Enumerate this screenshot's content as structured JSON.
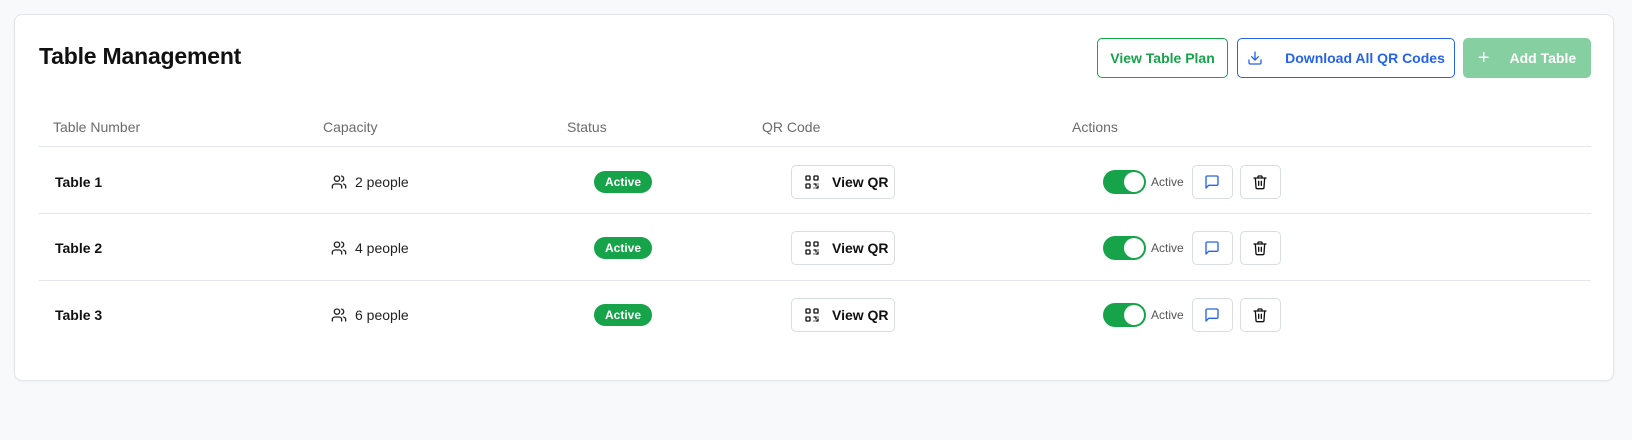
{
  "header": {
    "title": "Table Management",
    "view_plan_label": "View Table Plan",
    "download_label": "Download All QR Codes",
    "add_label": "Add Table"
  },
  "columns": [
    "Table Number",
    "Capacity",
    "Status",
    "QR Code",
    "Actions"
  ],
  "rows": [
    {
      "name": "Table 1",
      "capacity": "2 people",
      "status": "Active",
      "qr_label": "View QR",
      "toggle_label": "Active",
      "enabled": true
    },
    {
      "name": "Table 2",
      "capacity": "4 people",
      "status": "Active",
      "qr_label": "View QR",
      "toggle_label": "Active",
      "enabled": true
    },
    {
      "name": "Table 3",
      "capacity": "6 people",
      "status": "Active",
      "qr_label": "View QR",
      "toggle_label": "Active",
      "enabled": true
    }
  ],
  "icons": {
    "download": "download-icon",
    "plus": "plus-icon",
    "users": "users-icon",
    "qr": "qr-code-icon",
    "message": "message-square-icon",
    "delete": "trash-icon"
  },
  "colors": {
    "primary_green": "#16a34a",
    "primary_blue": "#2563eb",
    "add_button_disabled": "#86cfa0"
  }
}
